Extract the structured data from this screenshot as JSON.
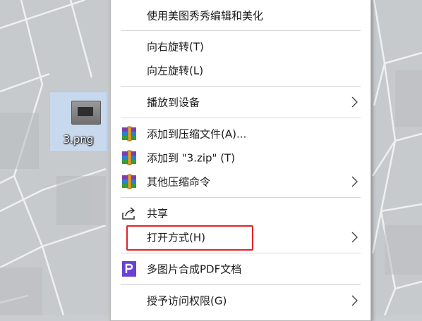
{
  "file": {
    "name": "3.png"
  },
  "menu": {
    "items": [
      {
        "label": "使用美图秀秀编辑和美化"
      },
      {
        "label": "向右旋转(T)"
      },
      {
        "label": "向左旋转(L)"
      },
      {
        "label": "播放到设备"
      },
      {
        "label": "添加到压缩文件(A)..."
      },
      {
        "label": "添加到 \"3.zip\" (T)"
      },
      {
        "label": "其他压缩命令"
      },
      {
        "label": "共享"
      },
      {
        "label": "打开方式(H)"
      },
      {
        "label": "多图片合成PDF文档"
      },
      {
        "label": "授予访问权限(G)"
      }
    ]
  },
  "icons": {
    "winrar": "winrar-archive-icon",
    "share": "share-icon",
    "pdf": "pdf-merge-icon",
    "submenu": "chevron-right-icon"
  },
  "colors": {
    "highlight": "#e3222a",
    "pdf_icon": "#6a3fd6",
    "selection": "#c8def6"
  }
}
